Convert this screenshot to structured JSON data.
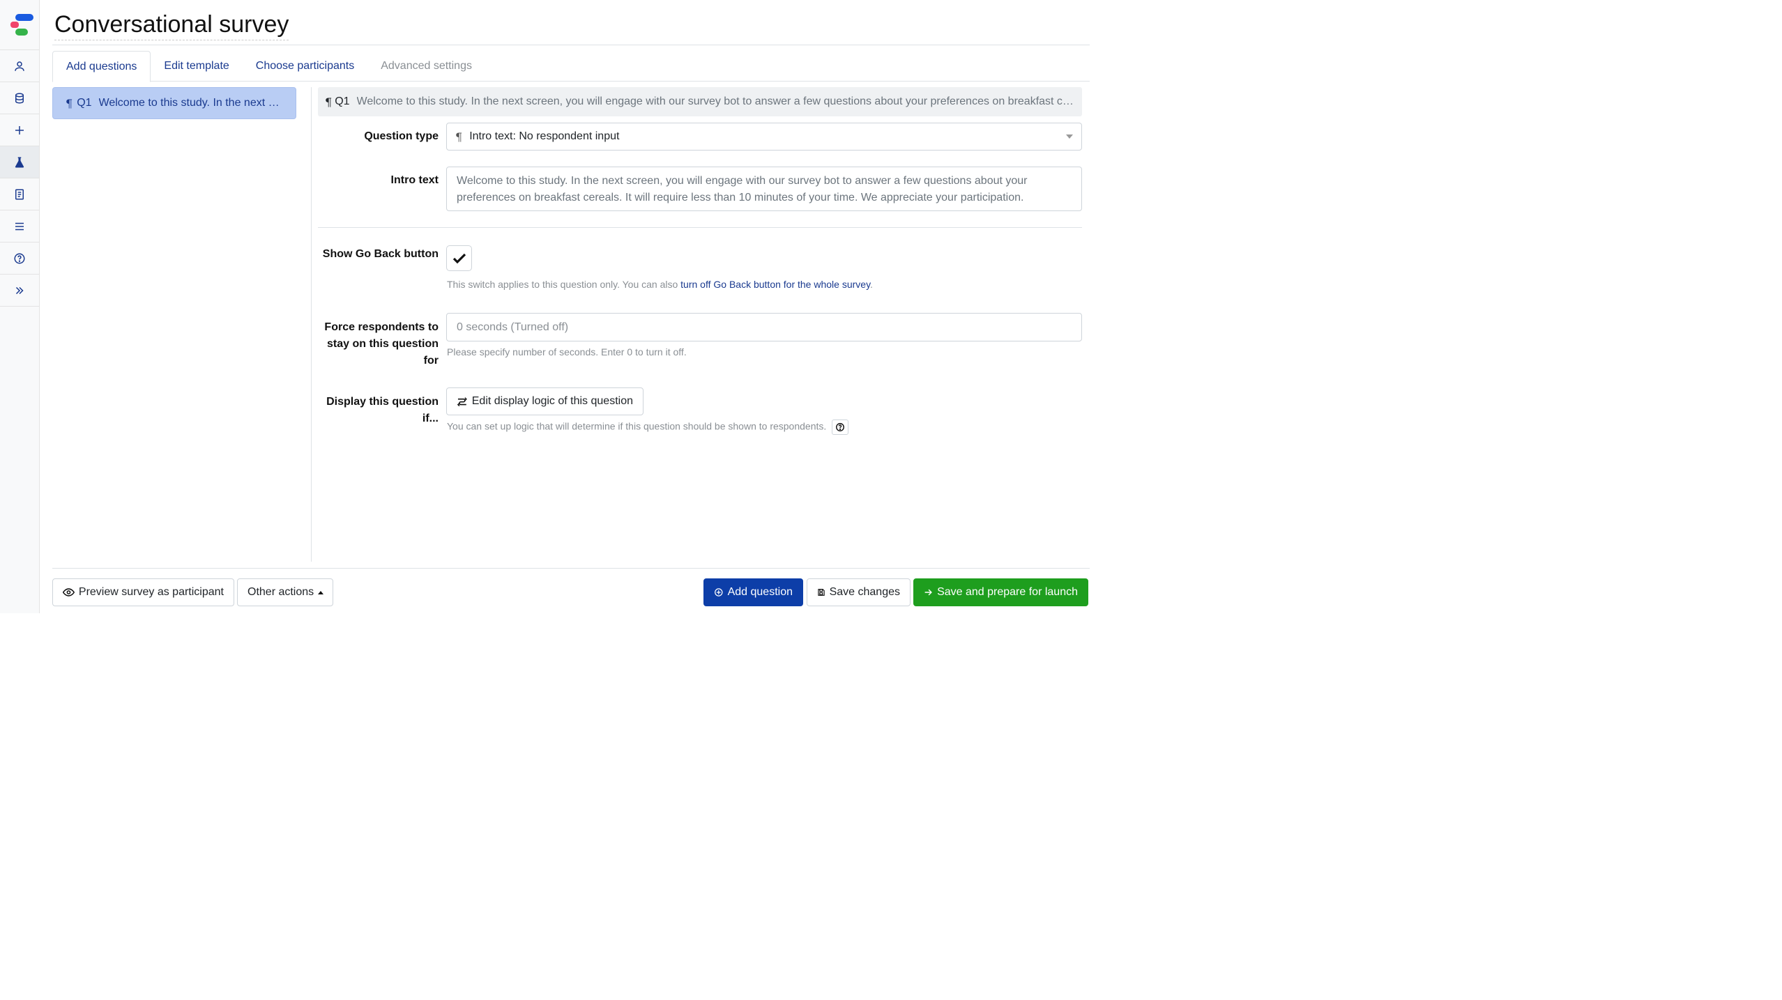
{
  "app": {
    "title": "Conversational survey"
  },
  "sidebar": {
    "items": [
      {
        "icon": "user-icon"
      },
      {
        "icon": "database-icon"
      },
      {
        "icon": "plus-icon"
      },
      {
        "icon": "flask-icon"
      },
      {
        "icon": "notebook-icon"
      },
      {
        "icon": "menu-icon"
      },
      {
        "icon": "help-icon"
      },
      {
        "icon": "expand-icon"
      }
    ]
  },
  "tabs": [
    {
      "label": "Add questions",
      "state": "active"
    },
    {
      "label": "Edit template",
      "state": "normal"
    },
    {
      "label": "Choose participants",
      "state": "normal"
    },
    {
      "label": "Advanced settings",
      "state": "disabled"
    }
  ],
  "question_list": [
    {
      "number": "Q1",
      "text": "Welcome to this study. In the next screen, you will engage with our survey bot to answer a few questions about your preferences on breakfast cereals. It will require less than 10 minutes of your time. We appreciate your participation."
    }
  ],
  "editor": {
    "header_number": "Q1",
    "header_text": "Welcome to this study. In the next screen, you will engage with our survey bot to answer a few questions about your preferences on breakfast cereals. It will require less than 10 minutes of your time. We appreciate your participation.",
    "question_type_label": "Question type",
    "question_type_value": "Intro text: No respondent input",
    "intro_text_label": "Intro text",
    "intro_text_value": "Welcome to this study. In the next screen, you will engage with our survey bot to answer a few questions about your preferences on breakfast cereals. It will require less than 10 minutes of your time. We appreciate your participation.",
    "go_back_label": "Show Go Back button",
    "go_back_checked": true,
    "go_back_help_prefix": "This switch applies to this question only. You can also ",
    "go_back_help_link": "turn off Go Back button for the whole survey",
    "go_back_help_suffix": ".",
    "force_label": "Force respondents to stay on this question for",
    "force_placeholder": "0 seconds (Turned off)",
    "force_help": "Please specify number of seconds. Enter 0 to turn it off.",
    "display_label": "Display this question if...",
    "display_button": "Edit display logic of this question",
    "display_help": "You can set up logic that will determine if this question should be shown to respondents."
  },
  "footer": {
    "preview_label": "Preview survey as participant",
    "other_actions_label": "Other actions",
    "add_question_label": "Add question",
    "save_changes_label": "Save changes",
    "save_launch_label": "Save and prepare for launch"
  },
  "colors": {
    "accent": "#1a3a8f",
    "primary": "#0d3ea8",
    "success": "#1e9e1e",
    "selected_item": "#b9cdf4"
  }
}
